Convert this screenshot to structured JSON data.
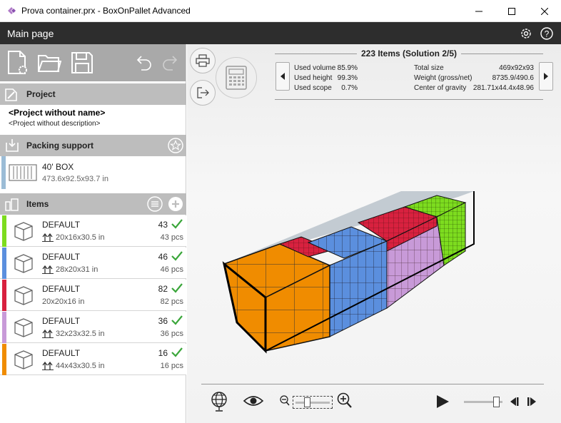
{
  "window": {
    "title": "Prova container.prx - BoxOnPallet Advanced",
    "brand_color": "#b07ac8"
  },
  "header": {
    "title": "Main page",
    "icons": [
      "gear-icon",
      "help-icon"
    ]
  },
  "toolbar": {
    "icons": [
      "new-document-icon",
      "open-folder-icon",
      "save-icon",
      "undo-icon",
      "redo-icon"
    ]
  },
  "project": {
    "section_label": "Project",
    "name": "<Project without name>",
    "description": "<Project without description>"
  },
  "packing_support": {
    "section_label": "Packing support",
    "name": "40' BOX",
    "dims": "473.6x92.5x93.7 in",
    "color": "#9bbcd6"
  },
  "items": {
    "section_label": "Items",
    "list": [
      {
        "name": "DEFAULT",
        "dims": "20x16x30.5 in",
        "count": "43",
        "pcs": "43 pcs",
        "color": "#7ddc1f",
        "orient": true
      },
      {
        "name": "DEFAULT",
        "dims": "28x20x31 in",
        "count": "46",
        "pcs": "46 pcs",
        "color": "#5b8fde",
        "orient": true
      },
      {
        "name": "DEFAULT",
        "dims": "20x20x16 in",
        "count": "82",
        "pcs": "82 pcs",
        "color": "#d8213f",
        "orient": false
      },
      {
        "name": "DEFAULT",
        "dims": "32x23x32.5 in",
        "count": "36",
        "pcs": "36 pcs",
        "color": "#c89ad8",
        "orient": true
      },
      {
        "name": "DEFAULT",
        "dims": "44x43x30.5 in",
        "count": "16",
        "pcs": "16 pcs",
        "color": "#f08c00",
        "orient": true
      }
    ]
  },
  "solution": {
    "title": "223 Items (Solution 2/5)",
    "left": [
      {
        "label": "Used volume",
        "value": "85.9%"
      },
      {
        "label": "Used height",
        "value": "99.3%"
      },
      {
        "label": "Used scope",
        "value": "0.7%"
      }
    ],
    "right": [
      {
        "label": "Total size",
        "value": "469x92x93"
      },
      {
        "label": "Weight (gross/net)",
        "value": "8735.9/490.6"
      },
      {
        "label": "Center of gravity",
        "value": "281.71x44.4x48.96"
      }
    ]
  },
  "playback": {
    "zoom_level": 0.3,
    "timeline_position": 0.9
  }
}
